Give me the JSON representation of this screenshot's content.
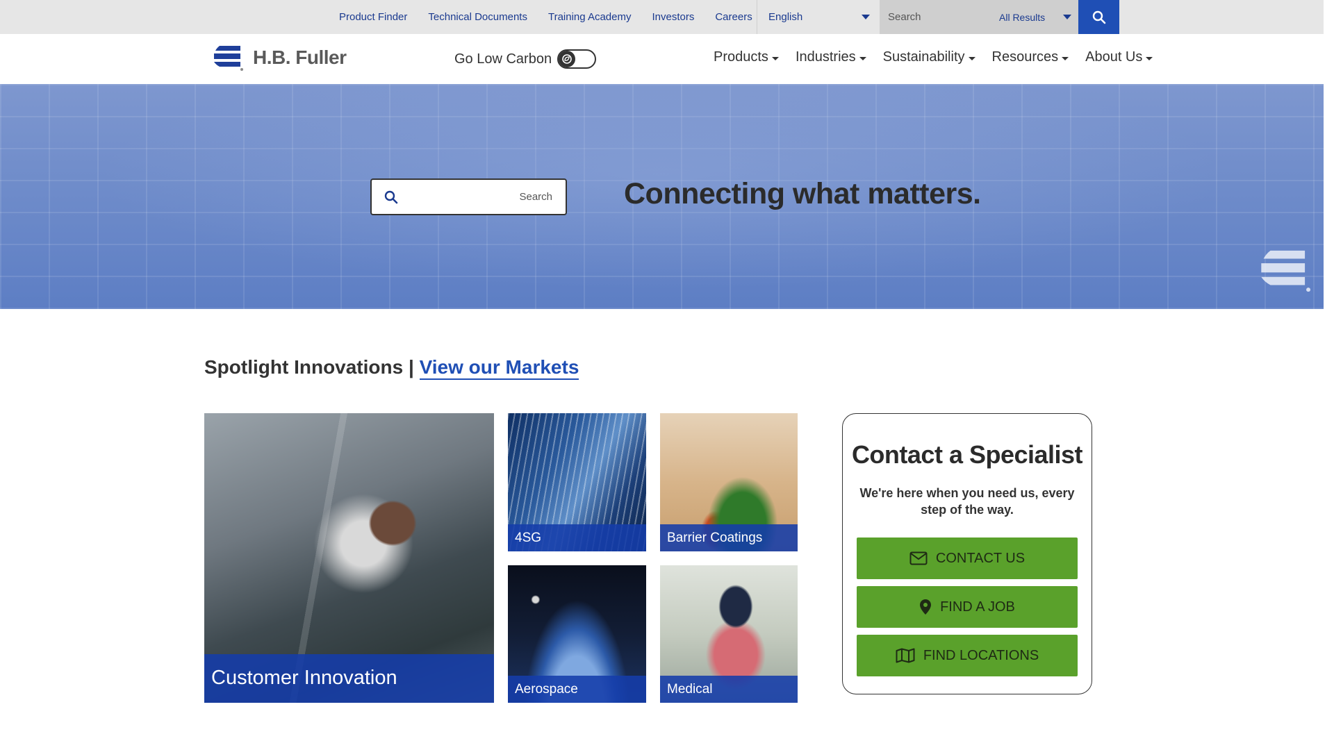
{
  "utility_bar": {
    "links": [
      "Product Finder",
      "Technical Documents",
      "Training Academy",
      "Investors",
      "Careers"
    ],
    "language": "English",
    "search_placeholder": "Search",
    "search_scope": "All Results"
  },
  "header": {
    "logo_text": "H.B. Fuller",
    "low_carbon_label": "Go Low Carbon",
    "nav": [
      "Products",
      "Industries",
      "Sustainability",
      "Resources",
      "About Us"
    ]
  },
  "hero": {
    "search_placeholder": "Search",
    "title": "Connecting what matters."
  },
  "spotlight": {
    "heading_prefix": "Spotlight Innovations |",
    "markets_link": "View our Markets",
    "tiles": {
      "customer_innovation": "Customer Innovation",
      "4sg": "4SG",
      "barrier_coatings": "Barrier Coatings",
      "aerospace": "Aerospace",
      "medical": "Medical"
    }
  },
  "contact": {
    "title": "Contact a Specialist",
    "subtitle": "We're here when you need us, every step of the way.",
    "contact_us": "CONTACT US",
    "find_job": "FIND A JOB",
    "find_locations": "FIND LOCATIONS"
  },
  "colors": {
    "brand_blue": "#1f4fb5",
    "cta_green": "#5aa12b",
    "utility_bg": "#e6e6e6"
  }
}
